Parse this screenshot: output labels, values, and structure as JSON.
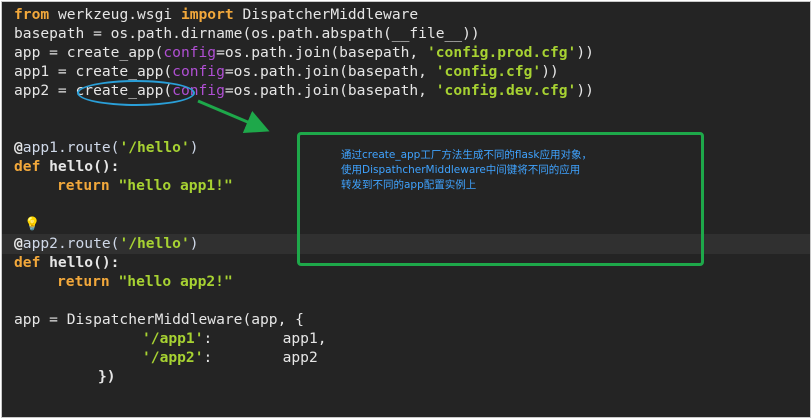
{
  "code": {
    "l1": {
      "kw1": "from",
      "t1": " werkzeug.wsgi ",
      "kw2": "import",
      "t2": " DispatcherMiddleware"
    },
    "l2": {
      "t1": "basepath = os.path.dirname(os.path.abspath(__file__))"
    },
    "l3": {
      "t1": "app = create_app(",
      "param": "config",
      "t2": "=os.path.join(basepath, ",
      "str": "'config.prod.cfg'",
      "t3": "))"
    },
    "l4": {
      "t1": "app1 = create_app(",
      "param": "config",
      "t2": "=os.path.join(basepath, ",
      "str": "'config.cfg'",
      "t3": "))"
    },
    "l5": {
      "t1": "app2 = create_app(",
      "param": "config",
      "t2": "=os.path.join(basepath, ",
      "str": "'config.dev.cfg'",
      "t3": "))"
    },
    "l6": {
      "at": "@",
      "t1": "app1.route(",
      "str": "'/hello'",
      "t2": ")"
    },
    "l7": {
      "kw": "def",
      "t1": " hello():"
    },
    "l8": {
      "kw": "return",
      "str": " \"hello app1!\""
    },
    "l9": {
      "at": "@",
      "t1": "app2.route(",
      "str": "'/hello'",
      "t2": ")"
    },
    "l10": {
      "kw": "def",
      "t1": " hello():"
    },
    "l11": {
      "kw": "return",
      "str": " \"hello app2!\""
    },
    "l12": {
      "t1": "app = DispatcherMiddleware(app, {"
    },
    "l13": {
      "str": "'/app1'",
      "t1": ":        app1,"
    },
    "l14": {
      "str": "'/app2'",
      "t1": ":        app2"
    },
    "l15": {
      "t1": "})"
    }
  },
  "annotation": {
    "text": "通过create_app工厂方法生成不同的flask应用对象，\n使用DispathcherMiddleware中间键将不同的应用\n转发到不同的app配置实例上"
  },
  "colors": {
    "background": "#242424",
    "keyword": "#f2a83b",
    "string": "#a7d232",
    "param": "#b04fd3",
    "annotation_border": "#1ea84a",
    "annotation_text": "#3fa3ff",
    "ellipse": "#2a9fd8",
    "arrow": "#1ea84a"
  },
  "icons": {
    "hint": "lightbulb-icon"
  }
}
